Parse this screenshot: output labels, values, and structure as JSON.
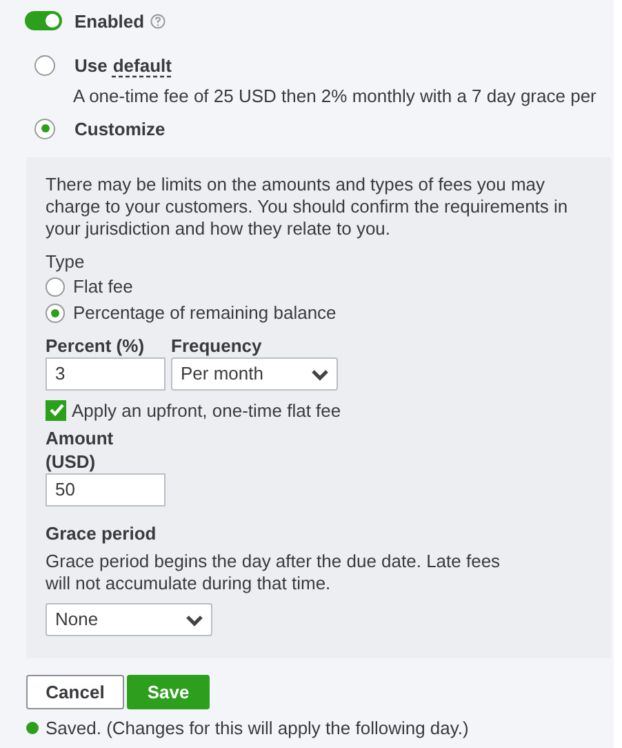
{
  "toggle": {
    "label": "Enabled",
    "on": true
  },
  "options": [
    {
      "label": "Use",
      "link": "default",
      "selected": false,
      "description": "A one-time fee of 25 USD then 2% monthly with a 7 day grace per"
    },
    {
      "label": "Customize",
      "selected": true
    }
  ],
  "customize": {
    "notice": "There may be limits on the amounts and types of fees you may charge to your customers. You should confirm the requirements in your jurisdiction and how they relate to you.",
    "type_label": "Type",
    "type_options": [
      {
        "label": "Flat fee",
        "selected": false
      },
      {
        "label": "Percentage of remaining balance",
        "selected": true
      }
    ],
    "percent": {
      "label": "Percent (%)",
      "value": "3"
    },
    "frequency": {
      "label": "Frequency",
      "value": "Per month"
    },
    "upfront": {
      "label": "Apply an upfront, one-time flat fee",
      "checked": true
    },
    "amount": {
      "label": "Amount (USD)",
      "value": "50"
    },
    "grace": {
      "title": "Grace period",
      "description": "Grace period begins the day after the due date. Late fees will not accumulate during that time.",
      "value": "None"
    }
  },
  "buttons": [
    {
      "label": "Cancel",
      "kind": "secondary"
    },
    {
      "label": "Save",
      "kind": "primary"
    }
  ],
  "status": {
    "text": "Saved. (Changes for this will apply the following day.)"
  }
}
